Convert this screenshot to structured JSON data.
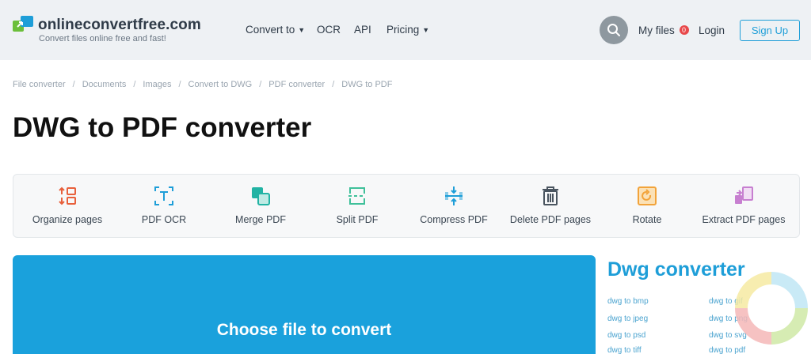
{
  "header": {
    "logo_name": "onlineconvertfree.com",
    "logo_tagline": "Convert files online free and fast!",
    "nav": {
      "convert_to": "Convert to",
      "ocr": "OCR",
      "api": "API",
      "pricing": "Pricing"
    },
    "my_files_label": "My files",
    "my_files_count": "0",
    "login_label": "Login",
    "signup_label": "Sign Up"
  },
  "breadcrumb": [
    "File converter",
    "Documents",
    "Images",
    "Convert to DWG",
    "PDF converter",
    "DWG to PDF"
  ],
  "page_title": "DWG to PDF converter",
  "tools": [
    {
      "label": "Organize pages",
      "icon": "organize-pages-icon",
      "color": "#e8603c"
    },
    {
      "label": "PDF OCR",
      "icon": "ocr-icon",
      "color": "#1e9ed8"
    },
    {
      "label": "Merge PDF",
      "icon": "merge-icon",
      "color": "#22b3a4"
    },
    {
      "label": "Split PDF",
      "icon": "split-icon",
      "color": "#3fc09a"
    },
    {
      "label": "Compress PDF",
      "icon": "compress-icon",
      "color": "#1e9ed8"
    },
    {
      "label": "Delete PDF pages",
      "icon": "trash-icon",
      "color": "#4a5560"
    },
    {
      "label": "Rotate",
      "icon": "rotate-icon",
      "color": "#f2a33a"
    },
    {
      "label": "Extract PDF pages",
      "icon": "extract-icon",
      "color": "#c77fd0"
    }
  ],
  "upload": {
    "title": "Choose file to convert"
  },
  "side_panel": {
    "title": "Dwg converter",
    "links_left": [
      "dwg to bmp",
      "dwg to jpeg",
      "dwg to psd",
      "dwg to tiff"
    ],
    "links_right": [
      "dwg to gif",
      "dwg to png",
      "dwg to svg",
      "dwg to pdf"
    ]
  },
  "colors": {
    "accent": "#1e9ed8",
    "upload_bg": "#1aa1dc",
    "header_bg": "#eef1f4",
    "badge": "#e8484a"
  }
}
